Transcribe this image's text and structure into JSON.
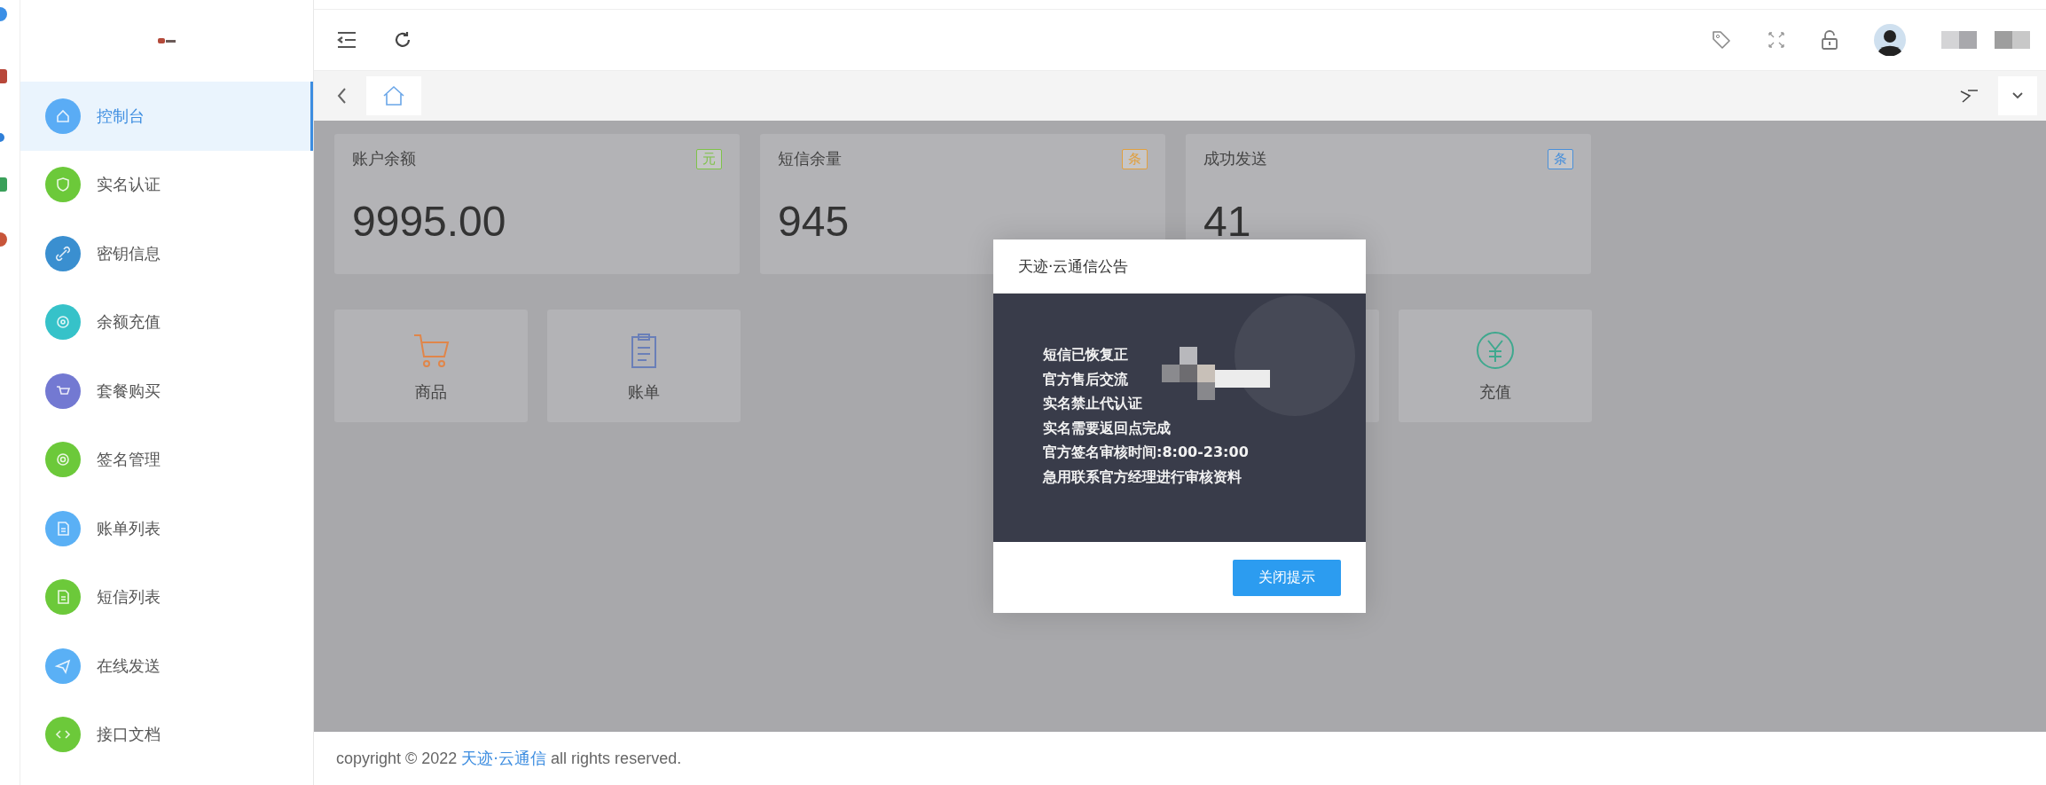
{
  "sidebar": {
    "items": [
      {
        "label": "控制台",
        "kind": "home",
        "color": "#5aacf5",
        "selected": true
      },
      {
        "label": "实名认证",
        "kind": "shield",
        "color": "#6cc93a",
        "selected": false
      },
      {
        "label": "密钥信息",
        "kind": "link",
        "color": "#3a8fd0",
        "selected": false
      },
      {
        "label": "余额充值",
        "kind": "coin",
        "color": "#36c2c9",
        "selected": false
      },
      {
        "label": "套餐购买",
        "kind": "cart",
        "color": "#7379d2",
        "selected": false
      },
      {
        "label": "签名管理",
        "kind": "at",
        "color": "#6cc93a",
        "selected": false
      },
      {
        "label": "账单列表",
        "kind": "doc",
        "color": "#5ab0f5",
        "selected": false
      },
      {
        "label": "短信列表",
        "kind": "doc",
        "color": "#6cc93a",
        "selected": false
      },
      {
        "label": "在线发送",
        "kind": "send",
        "color": "#5ab0f5",
        "selected": false
      },
      {
        "label": "接口文档",
        "kind": "code",
        "color": "#6cc93a",
        "selected": false
      }
    ]
  },
  "stat_cards": [
    {
      "label": "账户余额",
      "unit": "元",
      "color": "#7fc24a",
      "value": "9995.00"
    },
    {
      "label": "短信余量",
      "unit": "条",
      "color": "#e0a040",
      "value": "945"
    },
    {
      "label": "成功发送",
      "unit": "条",
      "color": "#4a90d9",
      "value": "41"
    }
  ],
  "shortcuts": [
    {
      "label": "商品",
      "kind": "cart",
      "color": "#e0864a"
    },
    {
      "label": "账单",
      "kind": "bill",
      "color": "#6a7fb8"
    },
    {
      "label": "充值",
      "kind": "yen",
      "color": "#3fa88e"
    }
  ],
  "dialog": {
    "title": "天迹·云通信公告",
    "lines": [
      "短信已恢复正",
      "官方售后交流",
      "实名禁止代认证",
      "实名需要返回点完成",
      "官方签名审核时间:8:00-23:00",
      "急用联系官方经理进行审核资料"
    ],
    "button": "关闭提示"
  },
  "footer": {
    "prefix": "copyright © 2022",
    "link": "天迹·云通信",
    "suffix": "all rights reserved."
  }
}
